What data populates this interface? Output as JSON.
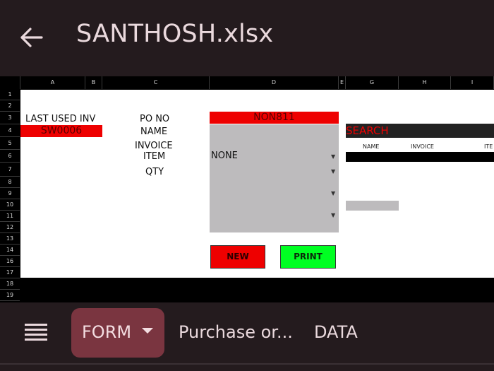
{
  "app": {
    "file_title": "SANTHOSH.xlsx",
    "back_icon": "arrow-left-icon"
  },
  "sheet": {
    "columns": [
      "A",
      "B",
      "C",
      "D",
      "E",
      "G",
      "H",
      "I"
    ],
    "rows": [
      "1",
      "2",
      "3",
      "4",
      "5",
      "6",
      "7",
      "8",
      "9",
      "10",
      "11",
      "12",
      "13",
      "14",
      "16",
      "17",
      "18",
      "19"
    ]
  },
  "form": {
    "last_used_inv_label": "LAST USED INV",
    "last_used_inv_value": "SW0006",
    "po_no_label": "PO NO",
    "po_no_value": "NON811",
    "name_label": "NAME",
    "invoice_label": "INVOICE",
    "item_label": "ITEM",
    "item_value": "NONE",
    "qty_label": "QTY",
    "new_button": "NEW",
    "print_button": "PRINT"
  },
  "search": {
    "label": "SEARCH",
    "columns": [
      "NAME",
      "INVOICE",
      "ITE"
    ]
  },
  "tabs": {
    "menu_icon": "hamburger-menu-icon",
    "items": [
      {
        "label": "FORM",
        "active": true
      },
      {
        "label": "Purchase or...",
        "active": false
      },
      {
        "label": "DATA",
        "active": false
      }
    ]
  },
  "colors": {
    "background": "#241b1e",
    "active_tab": "#7a3540",
    "red": "#ee0000",
    "green": "#00ff22",
    "panel_gray": "#bdbbbd"
  }
}
